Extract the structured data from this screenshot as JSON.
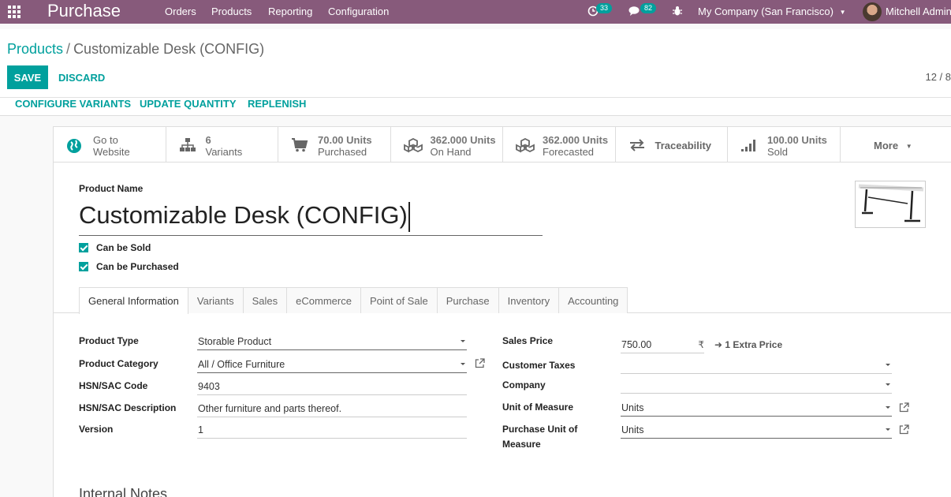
{
  "navbar": {
    "app_title": "Purchase",
    "menu": [
      "Orders",
      "Products",
      "Reporting",
      "Configuration"
    ],
    "activity_count": "33",
    "message_count": "82",
    "company": "My Company (San Francisco)",
    "user": "Mitchell Admin"
  },
  "breadcrumb": {
    "parent": "Products",
    "separator": "/",
    "current": "Customizable Desk (CONFIG)"
  },
  "buttons": {
    "save": "SAVE",
    "discard": "DISCARD"
  },
  "pager": "12 / 8",
  "actions": [
    "CONFIGURE VARIANTS",
    "UPDATE QUANTITY",
    "REPLENISH"
  ],
  "smart_buttons": [
    {
      "value": "Go to",
      "label": "Website",
      "icon": "globe-icon"
    },
    {
      "value": "6",
      "label": "Variants",
      "icon": "sitemap-icon"
    },
    {
      "value": "70.00 Units",
      "label": "Purchased",
      "icon": "cart-icon"
    },
    {
      "value": "362.000 Units",
      "label": "On Hand",
      "icon": "cubes-icon"
    },
    {
      "value": "362.000 Units",
      "label": "Forecasted",
      "icon": "cubes-icon"
    },
    {
      "value": "Traceability",
      "label": "",
      "icon": "exchange-icon"
    },
    {
      "value": "100.00 Units",
      "label": "Sold",
      "icon": "signal-icon"
    }
  ],
  "more": "More",
  "product": {
    "name_label": "Product Name",
    "name": "Customizable Desk (CONFIG)",
    "can_be_sold": "Can be Sold",
    "can_be_purchased": "Can be Purchased"
  },
  "tabs": [
    "General Information",
    "Variants",
    "Sales",
    "eCommerce",
    "Point of Sale",
    "Purchase",
    "Inventory",
    "Accounting"
  ],
  "left_fields": {
    "product_type": {
      "label": "Product Type",
      "value": "Storable Product"
    },
    "product_category": {
      "label": "Product Category",
      "value": "All / Office Furniture"
    },
    "hsn_code": {
      "label": "HSN/SAC Code",
      "value": "9403"
    },
    "hsn_desc": {
      "label": "HSN/SAC Description",
      "value": "Other furniture and parts thereof."
    },
    "version": {
      "label": "Version",
      "value": "1"
    }
  },
  "right_fields": {
    "sales_price": {
      "label": "Sales Price",
      "value": "750.00",
      "currency": "₹"
    },
    "extra_price": "1 Extra Price",
    "customer_taxes": {
      "label": "Customer Taxes",
      "value": ""
    },
    "company": {
      "label": "Company",
      "value": ""
    },
    "uom": {
      "label": "Unit of Measure",
      "value": "Units"
    },
    "purchase_uom": {
      "label_line1": "Purchase Unit of",
      "label_line2": "Measure",
      "value": "Units"
    }
  },
  "internal_notes": "Internal Notes",
  "colors": {
    "navbar": "#875a7b",
    "accent": "#00a09d"
  }
}
